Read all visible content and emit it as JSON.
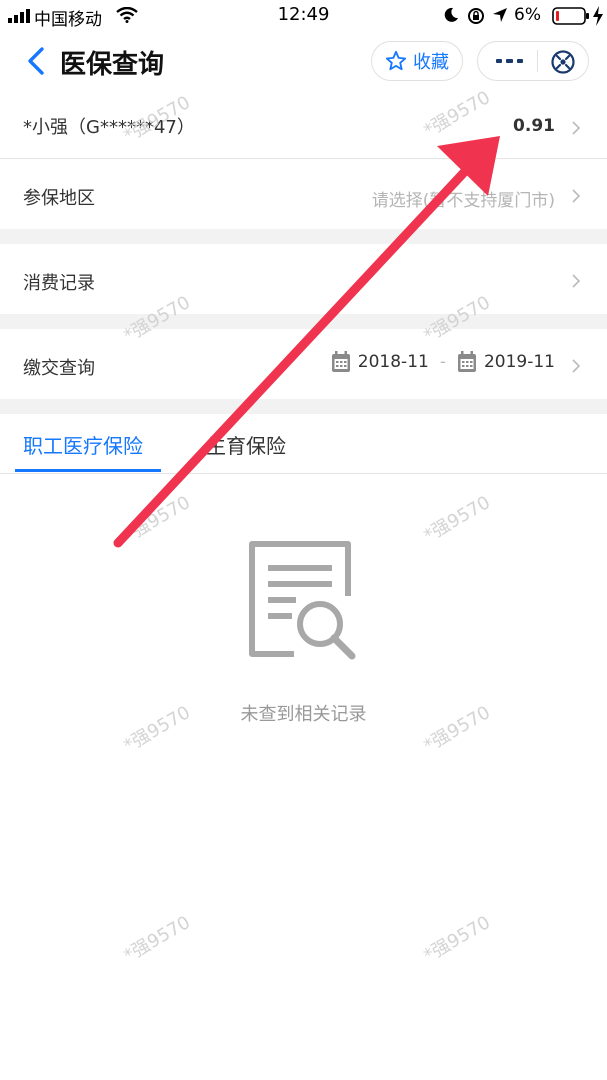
{
  "status_bar": {
    "carrier": "中国移动",
    "time": "12:49",
    "battery": "6%"
  },
  "nav": {
    "title": "医保查询",
    "favorite_label": "收藏",
    "back_icon": "chevron-left-icon",
    "more_icon": "more-dots-icon",
    "close_icon": "close-circle-icon"
  },
  "account": {
    "name": "*小强（G******47）",
    "balance": "0.91"
  },
  "region": {
    "label": "参保地区",
    "placeholder": "请选择(暂不支持厦门市)"
  },
  "consumption": {
    "label": "消费记录"
  },
  "payment": {
    "label": "缴交查询",
    "start": "2018-11",
    "sep": "-",
    "end": "2019-11"
  },
  "tabs": [
    {
      "label": "职工医疗保险",
      "active": true
    },
    {
      "label": "生育保险",
      "active": false
    }
  ],
  "empty": {
    "text": "未查到相关记录",
    "icon": "document-search-icon"
  },
  "watermark": "*强9570",
  "colors": {
    "accent": "#1677ff",
    "annotation_arrow": "#f0334e",
    "section_gap": "#f2f2f2"
  }
}
